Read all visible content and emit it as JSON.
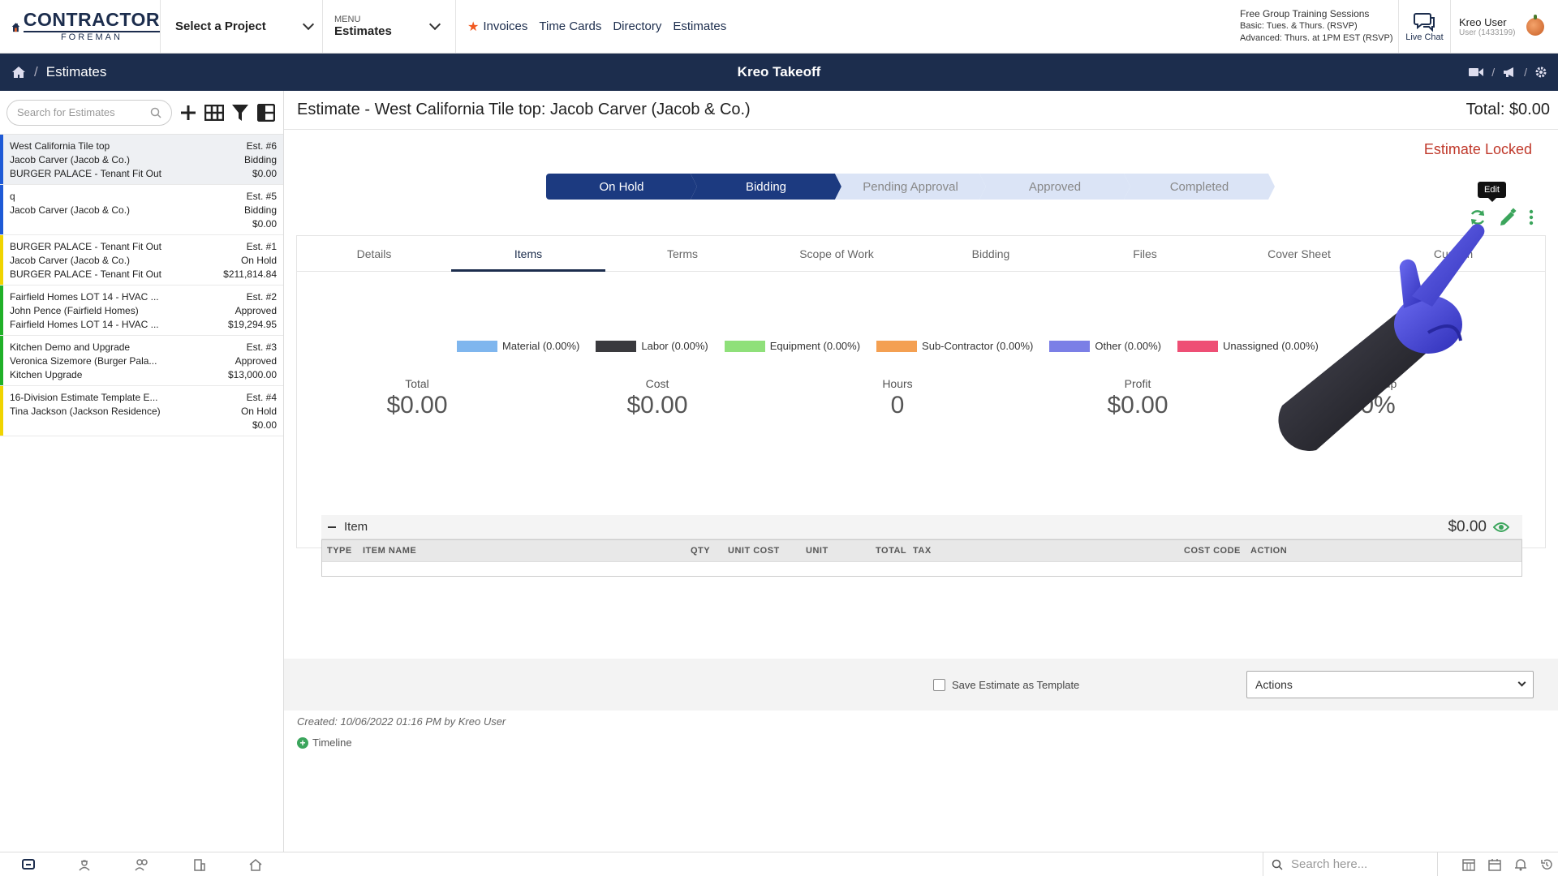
{
  "topbar": {
    "logo_line1": "CONTRACTOR",
    "logo_line2": "FOREMAN",
    "project_select": "Select a Project",
    "menu_label": "MENU",
    "menu_value": "Estimates",
    "quicklinks": [
      "Invoices",
      "Time Cards",
      "Directory",
      "Estimates"
    ],
    "training_title": "Free Group Training Sessions",
    "training_basic": "Basic: Tues. & Thurs. (RSVP)",
    "training_advanced": "Advanced: Thurs. at 1PM EST (RSVP)",
    "live_chat": "Live Chat",
    "user_name": "Kreo User",
    "user_id": "User (1433199)"
  },
  "navbar": {
    "breadcrumb": "Estimates",
    "title": "Kreo Takeoff"
  },
  "sidebar": {
    "search_placeholder": "Search for Estimates",
    "estimates": [
      {
        "line1": "West California Tile top",
        "line2": "Jacob Carver (Jacob & Co.)",
        "line3": "BURGER PALACE - Tenant Fit Out",
        "num": "Est. #6",
        "status": "Bidding",
        "amount": "$0.00",
        "color": "#1e5ad6"
      },
      {
        "line1": "q",
        "line2": "Jacob Carver (Jacob & Co.)",
        "line3": "",
        "num": "Est. #5",
        "status": "Bidding",
        "amount": "$0.00",
        "color": "#1e5ad6"
      },
      {
        "line1": "BURGER PALACE - Tenant Fit Out",
        "line2": "Jacob Carver (Jacob & Co.)",
        "line3": "BURGER PALACE - Tenant Fit Out",
        "num": "Est. #1",
        "status": "On Hold",
        "amount": "$211,814.84",
        "color": "#f0d400"
      },
      {
        "line1": "Fairfield Homes LOT 14 - HVAC ...",
        "line2": "John Pence (Fairfield Homes)",
        "line3": "Fairfield Homes LOT 14 - HVAC ...",
        "num": "Est. #2",
        "status": "Approved",
        "amount": "$19,294.95",
        "color": "#20b028"
      },
      {
        "line1": "Kitchen Demo and Upgrade",
        "line2": "Veronica Sizemore (Burger Pala...",
        "line3": "Kitchen Upgrade",
        "num": "Est. #3",
        "status": "Approved",
        "amount": "$13,000.00",
        "color": "#20b028"
      },
      {
        "line1": "16-Division Estimate Template E...",
        "line2": "Tina Jackson (Jackson Residence)",
        "line3": "",
        "num": "Est. #4",
        "status": "On Hold",
        "amount": "$0.00",
        "color": "#f0d400"
      }
    ]
  },
  "estimate": {
    "title": "Estimate - West California Tile top: Jacob Carver (Jacob & Co.)",
    "total": "Total: $0.00",
    "locked": "Estimate Locked",
    "steps": [
      {
        "label": "On Hold",
        "done": true
      },
      {
        "label": "Bidding",
        "done": true
      },
      {
        "label": "Pending Approval",
        "done": false
      },
      {
        "label": "Approved",
        "done": false
      },
      {
        "label": "Completed",
        "done": false
      }
    ],
    "tooltip": "Edit",
    "tabs": [
      "Details",
      "Items",
      "Terms",
      "Scope of Work",
      "Bidding",
      "Files",
      "Cover Sheet",
      "Custom"
    ],
    "active_tab": "Items",
    "legend": [
      {
        "label": "Material (0.00%)",
        "color": "#7fb6ee"
      },
      {
        "label": "Labor (0.00%)",
        "color": "#3a3a3e"
      },
      {
        "label": "Equipment (0.00%)",
        "color": "#8fe07a"
      },
      {
        "label": "Sub-Contractor (0.00%)",
        "color": "#f4a052"
      },
      {
        "label": "Other (0.00%)",
        "color": "#7b7fe6"
      },
      {
        "label": "Unassigned (0.00%)",
        "color": "#ee4f75"
      }
    ],
    "stats": [
      {
        "label": "Total",
        "value": "$0.00"
      },
      {
        "label": "Cost",
        "value": "$0.00"
      },
      {
        "label": "Hours",
        "value": "0"
      },
      {
        "label": "Profit",
        "value": "$0.00"
      },
      {
        "label": "Markup",
        "value": "0%"
      }
    ],
    "items_section": "Item",
    "items_total": "$0.00",
    "columns": [
      "TYPE",
      "ITEM NAME",
      "QTY",
      "UNIT COST",
      "UNIT",
      "TOTAL",
      "TAX",
      "COST CODE",
      "ACTION"
    ],
    "save_template": "Save Estimate as Template",
    "actions": "Actions",
    "created": "Created: 10/06/2022 01:16 PM by Kreo User",
    "timeline": "Timeline"
  },
  "bottombar": {
    "search_placeholder": "Search here..."
  }
}
